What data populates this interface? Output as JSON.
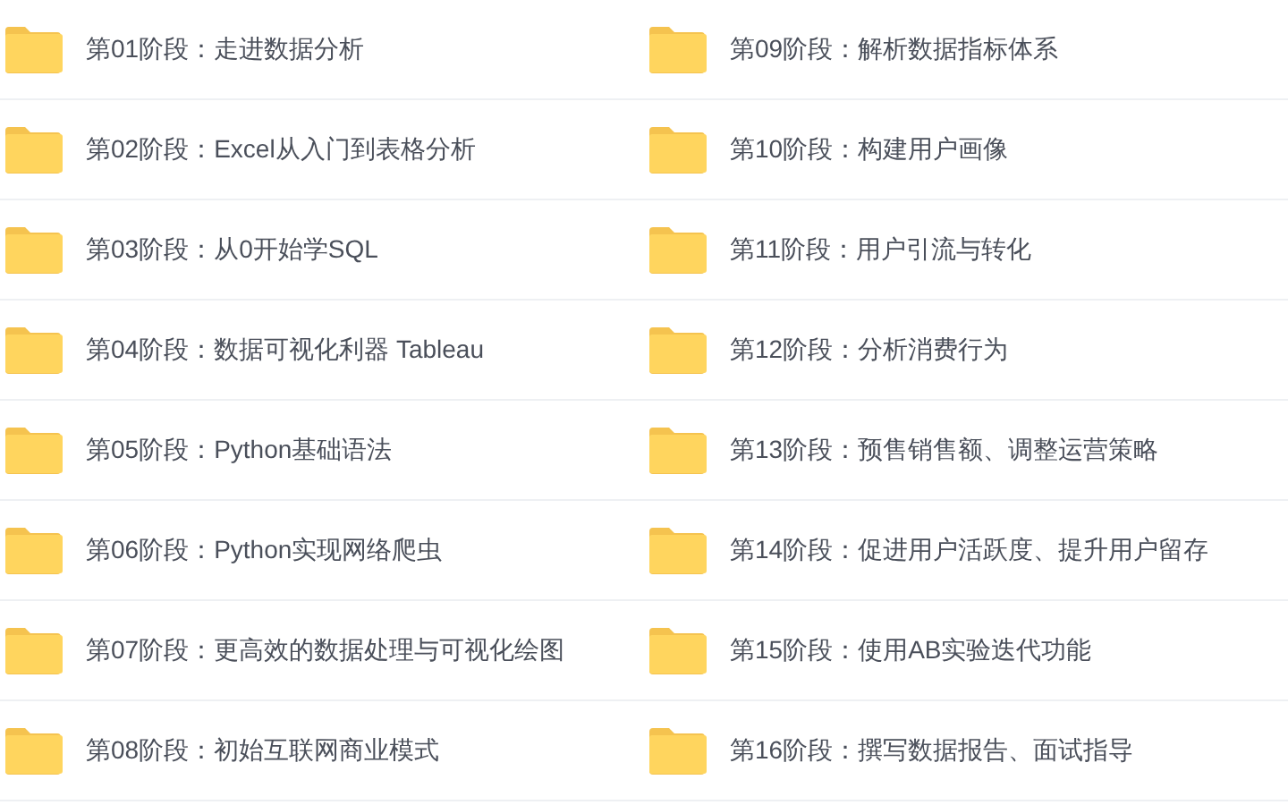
{
  "columns": [
    {
      "folders": [
        {
          "name": "第01阶段：走进数据分析"
        },
        {
          "name": "第02阶段：Excel从入门到表格分析"
        },
        {
          "name": "第03阶段：从0开始学SQL"
        },
        {
          "name": "第04阶段：数据可视化利器 Tableau"
        },
        {
          "name": "第05阶段：Python基础语法"
        },
        {
          "name": "第06阶段：Python实现网络爬虫"
        },
        {
          "name": "第07阶段：更高效的数据处理与可视化绘图"
        },
        {
          "name": "第08阶段：初始互联网商业模式"
        }
      ]
    },
    {
      "folders": [
        {
          "name": "第09阶段：解析数据指标体系"
        },
        {
          "name": "第10阶段：构建用户画像"
        },
        {
          "name": "第11阶段：用户引流与转化"
        },
        {
          "name": "第12阶段：分析消费行为"
        },
        {
          "name": "第13阶段：预售销售额、调整运营策略"
        },
        {
          "name": "第14阶段：促进用户活跃度、提升用户留存"
        },
        {
          "name": "第15阶段：使用AB实验迭代功能"
        },
        {
          "name": "第16阶段：撰写数据报告、面试指导"
        }
      ]
    }
  ]
}
